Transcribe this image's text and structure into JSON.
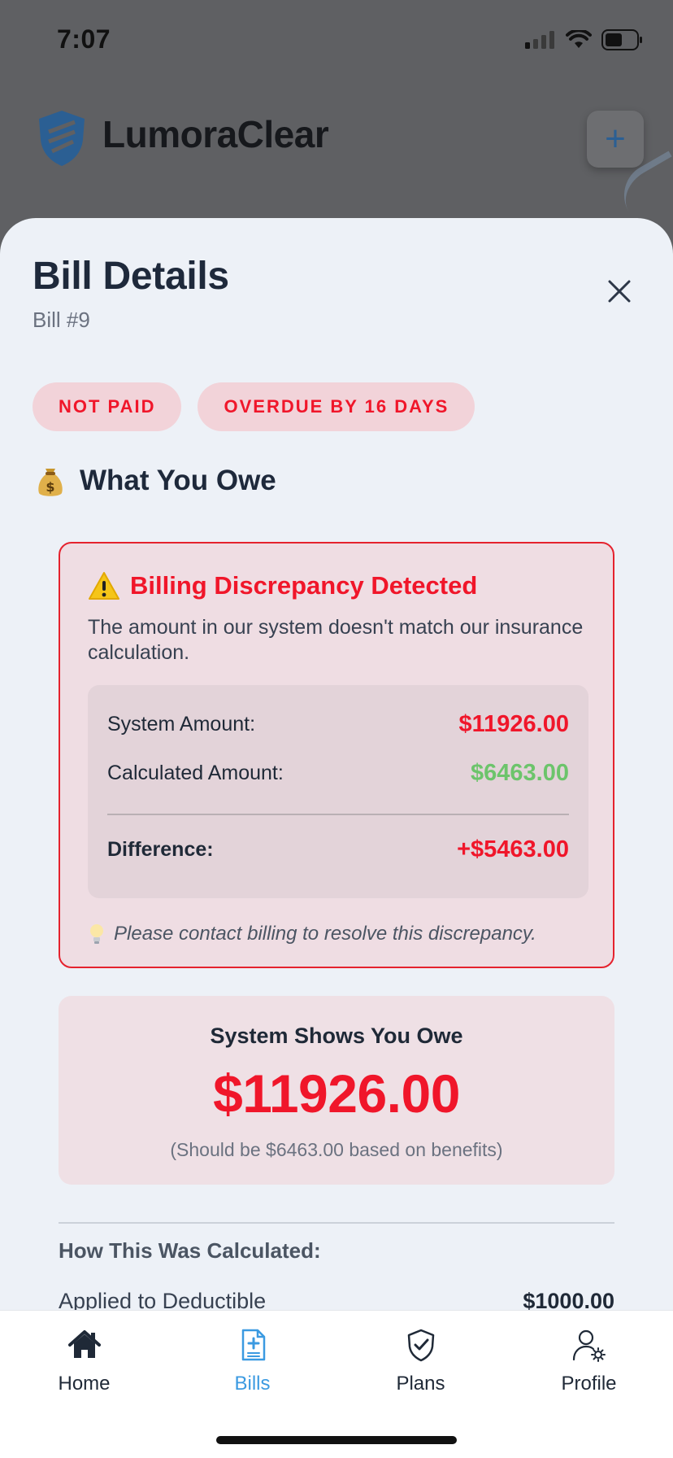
{
  "status_bar": {
    "time": "7:07"
  },
  "background_app": {
    "title": "LumoraClear",
    "add_button": "+"
  },
  "sheet": {
    "title": "Bill Details",
    "subtitle": "Bill #9",
    "badges": [
      "NOT PAID",
      "OVERDUE BY 16 DAYS"
    ],
    "section_title": "What You Owe"
  },
  "discrepancy": {
    "title": "Billing Discrepancy Detected",
    "description": "The amount in our system doesn't match our insurance calculation.",
    "system_label": "System Amount:",
    "system_value": "$11926.00",
    "calculated_label": "Calculated Amount:",
    "calculated_value": "$6463.00",
    "difference_label": "Difference:",
    "difference_value": "+$5463.00",
    "note": "Please contact billing to resolve this discrepancy."
  },
  "owe": {
    "label": "System Shows You Owe",
    "amount": "$11926.00",
    "note": "(Should be $6463.00 based on benefits)"
  },
  "calculation": {
    "title": "How This Was Calculated:",
    "rows": [
      {
        "label": "Applied to Deductible",
        "value": "$1000.00"
      }
    ]
  },
  "tabs": [
    {
      "label": "Home",
      "icon": "home-icon"
    },
    {
      "label": "Bills",
      "icon": "bill-icon"
    },
    {
      "label": "Plans",
      "icon": "shield-check-icon"
    },
    {
      "label": "Profile",
      "icon": "user-settings-icon"
    }
  ],
  "active_tab": "Bills",
  "colors": {
    "alert": "#f0162a",
    "positive": "#6cc46b",
    "accent": "#3b9ae1"
  }
}
